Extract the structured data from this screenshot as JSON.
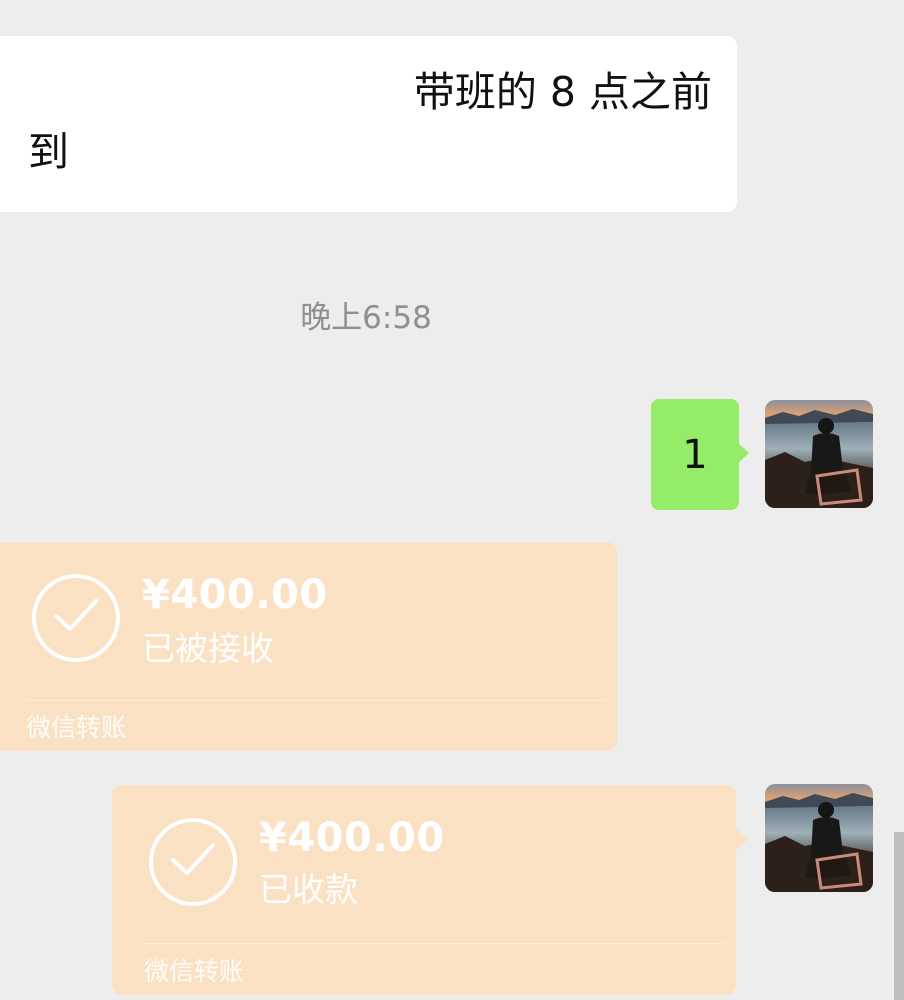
{
  "messages": {
    "incoming_text": {
      "line1": "带班的 8 点之前",
      "line2": "到"
    },
    "timestamp": "晚上6:58",
    "outgoing_text": "1",
    "transfer_received": {
      "amount": "¥400.00",
      "status": "已被接收",
      "footer": "微信转账"
    },
    "transfer_sent": {
      "amount": "¥400.00",
      "status": "已收款",
      "footer": "微信转账"
    }
  },
  "colors": {
    "background": "#ededed",
    "incoming_bubble": "#ffffff",
    "outgoing_bubble": "#95ec69",
    "transfer_card": "#fbe1c4"
  },
  "icons": {
    "avatar": "avatar-photo",
    "transfer_status": "check-circle-icon"
  }
}
